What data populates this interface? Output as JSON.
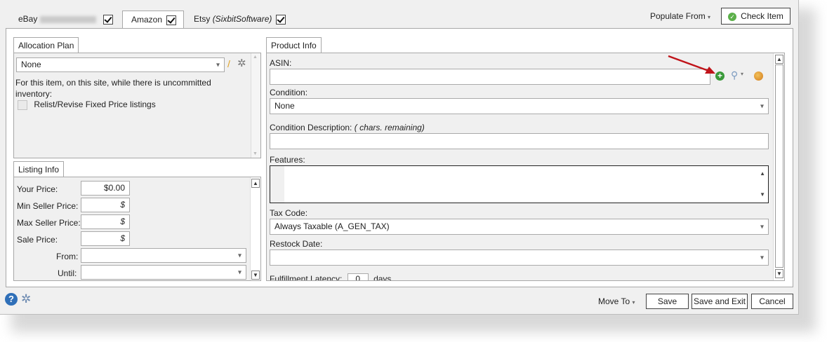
{
  "site_tabs": [
    {
      "label": "eBay",
      "checked": true
    },
    {
      "label": "Amazon",
      "checked": true
    },
    {
      "label": "Etsy",
      "account": "(SixbitSoftware)",
      "checked": true
    }
  ],
  "header": {
    "populate_from": "Populate From",
    "check_item": "Check Item"
  },
  "allocation": {
    "tab": "Allocation Plan",
    "plan_value": "None",
    "note": "For this item, on this site, while there is uncommitted inventory:",
    "relist_label": "Relist/Revise Fixed Price listings",
    "relist_checked": false
  },
  "listing": {
    "tab": "Listing Info",
    "your_price_label": "Your Price:",
    "your_price": "$0.00",
    "min_label": "Min Seller Price:",
    "min_value": "$",
    "max_label": "Max Seller Price:",
    "max_value": "$",
    "sale_label": "Sale Price:",
    "sale_value": "$",
    "from_label": "From:",
    "from_value": "",
    "until_label": "Until:",
    "until_value": ""
  },
  "product": {
    "tab": "Product Info",
    "asin_label": "ASIN:",
    "asin_value": "",
    "condition_label": "Condition:",
    "condition_value": "None",
    "cond_desc_label": "Condition Description:",
    "cond_desc_note": "( chars. remaining)",
    "cond_desc_value": "",
    "features_label": "Features:",
    "features_value": "",
    "tax_label": "Tax Code:",
    "tax_value": "Always Taxable  (A_GEN_TAX)",
    "restock_label": "Restock Date:",
    "restock_value": "",
    "fulfillment_label": "Fulfillment Latency:",
    "fulfillment_value": "0",
    "fulfillment_unit": "days"
  },
  "footer": {
    "move_to": "Move To",
    "save": "Save",
    "save_exit": "Save and Exit",
    "cancel": "Cancel"
  },
  "colors": {
    "accent_arrow": "#c0141a",
    "add_icon": "#3a9a3a",
    "help_icon": "#2f6fb8"
  }
}
